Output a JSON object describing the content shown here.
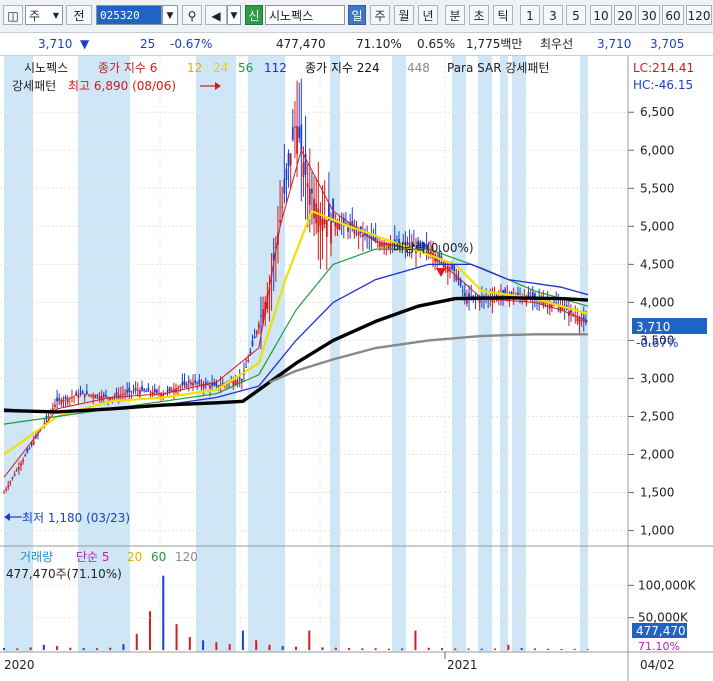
{
  "toolbar": {
    "item_label": "주",
    "prev_label": "전",
    "code": "025320",
    "stock_name": "시노펙스",
    "new_badge": "신",
    "periods": [
      "일",
      "주",
      "월",
      "년",
      "분",
      "초",
      "틱"
    ],
    "active_period": "일",
    "numbers": [
      "1",
      "3",
      "5",
      "10",
      "20",
      "30",
      "60",
      "120"
    ]
  },
  "quote": {
    "price": "3,710",
    "change": "25",
    "change_pct": "-0.67%",
    "volume": "477,470",
    "vol_ratio": "71.10%",
    "turnover": "0.65%",
    "amount": "1,775백만",
    "priority_label": "최우선",
    "ask": "3,710",
    "bid": "3,705",
    "colors": {
      "down": "#1a3fcf",
      "up": "#d21b1b"
    }
  },
  "price_panel": {
    "legend": [
      {
        "label": "시노펙스",
        "color": "#222222"
      },
      {
        "label": "종가 지수 6",
        "color": "#d21b1b"
      },
      {
        "label": "12",
        "color": "#e0b000"
      },
      {
        "label": "24",
        "color": "#d8d800"
      },
      {
        "label": "56",
        "color": "#1f9b3a"
      },
      {
        "label": "112",
        "color": "#1f2fcf"
      },
      {
        "label": "종가 지수 224",
        "color": "#111111"
      },
      {
        "label": "448",
        "color": "#888888"
      },
      {
        "label": "Para SAR 강세패턴",
        "color": "#222222"
      }
    ],
    "legend_line2": "강세패턴",
    "lc": "LC:214.41",
    "hc": "HC:-46.15",
    "annotation_high": "최고 6,890 (08/06)",
    "annotation_low": "최저 1,180 (03/23)",
    "annotation_ex": "배당락(0.00%)",
    "current_price_tag": "3,710",
    "current_change_tag": "-0.67%",
    "tick_labels": [
      "6,500",
      "6,000",
      "5,500",
      "5,000",
      "4,500",
      "4,000",
      "3,500",
      "3,000",
      "2,500",
      "2,000",
      "1,500",
      "1,000"
    ]
  },
  "volume_panel": {
    "legend": [
      {
        "label": "거래량",
        "color": "#1f8fcf"
      },
      {
        "label": "단순 5",
        "color": "#c01bc0"
      },
      {
        "label": "20",
        "color": "#e0b000"
      },
      {
        "label": "60",
        "color": "#1f9b3a"
      },
      {
        "label": "120",
        "color": "#888888"
      }
    ],
    "info": "477,470주(71.10%)",
    "tick_labels": [
      "100,000K",
      "50,000K"
    ],
    "current_tag": "477,470",
    "current_pct": "71.10%"
  },
  "x_axis": {
    "labels": [
      "2020",
      "2021",
      "04/02"
    ]
  },
  "chart_data": {
    "type": "line",
    "title": "시노펙스",
    "y_range": [
      850,
      6950
    ],
    "y_ticks": [
      1000,
      1500,
      2000,
      2500,
      3000,
      3500,
      4000,
      4500,
      5000,
      5500,
      6000,
      6500
    ],
    "y_tick_labels": [
      "1,000",
      "1,500",
      "2,000",
      "2,500",
      "3,000",
      "3,500",
      "4,000",
      "4,500",
      "5,000",
      "5,500",
      "6,000",
      "6,500"
    ],
    "x_labels": [
      "2020",
      "2021",
      "04/02"
    ],
    "series": [
      {
        "name": "시노펙스",
        "points": [
          [
            0,
            1500
          ],
          [
            5,
            2100
          ],
          [
            10,
            2700
          ],
          [
            15,
            2800
          ],
          [
            20,
            2750
          ],
          [
            25,
            2850
          ],
          [
            30,
            2800
          ],
          [
            35,
            2950
          ],
          [
            40,
            2900
          ],
          [
            45,
            3000
          ],
          [
            50,
            4200
          ],
          [
            55,
            6400
          ],
          [
            57,
            5600
          ],
          [
            60,
            5100
          ],
          [
            65,
            5000
          ],
          [
            70,
            4800
          ],
          [
            75,
            4750
          ],
          [
            80,
            4700
          ],
          [
            85,
            4400
          ],
          [
            87,
            4050
          ],
          [
            90,
            4050
          ],
          [
            95,
            4100
          ],
          [
            100,
            4050
          ],
          [
            105,
            3950
          ],
          [
            110,
            3710
          ]
        ]
      },
      {
        "name": "6",
        "points": [
          [
            0,
            1700
          ],
          [
            10,
            2600
          ],
          [
            20,
            2750
          ],
          [
            30,
            2800
          ],
          [
            40,
            2950
          ],
          [
            48,
            3400
          ],
          [
            52,
            5000
          ],
          [
            56,
            6000
          ],
          [
            62,
            5200
          ],
          [
            70,
            4800
          ],
          [
            80,
            4650
          ],
          [
            86,
            4300
          ],
          [
            90,
            4050
          ],
          [
            100,
            4000
          ],
          [
            105,
            3900
          ],
          [
            110,
            3750
          ]
        ]
      },
      {
        "name": "24",
        "points": [
          [
            0,
            2000
          ],
          [
            10,
            2500
          ],
          [
            20,
            2700
          ],
          [
            30,
            2750
          ],
          [
            40,
            2850
          ],
          [
            48,
            3200
          ],
          [
            53,
            4300
          ],
          [
            58,
            5200
          ],
          [
            65,
            5000
          ],
          [
            75,
            4750
          ],
          [
            85,
            4500
          ],
          [
            90,
            4150
          ],
          [
            100,
            4050
          ],
          [
            110,
            3850
          ]
        ]
      },
      {
        "name": "56",
        "points": [
          [
            0,
            2400
          ],
          [
            10,
            2500
          ],
          [
            20,
            2600
          ],
          [
            30,
            2700
          ],
          [
            40,
            2800
          ],
          [
            48,
            3050
          ],
          [
            55,
            3900
          ],
          [
            62,
            4500
          ],
          [
            70,
            4700
          ],
          [
            80,
            4700
          ],
          [
            90,
            4450
          ],
          [
            100,
            4150
          ],
          [
            110,
            3950
          ]
        ]
      },
      {
        "name": "112",
        "points": [
          [
            0,
            2600
          ],
          [
            10,
            2550
          ],
          [
            20,
            2600
          ],
          [
            30,
            2650
          ],
          [
            40,
            2750
          ],
          [
            48,
            2900
          ],
          [
            55,
            3500
          ],
          [
            62,
            4000
          ],
          [
            70,
            4300
          ],
          [
            80,
            4500
          ],
          [
            88,
            4500
          ],
          [
            95,
            4300
          ],
          [
            105,
            4200
          ],
          [
            110,
            4100
          ]
        ]
      },
      {
        "name": "224",
        "points": [
          [
            0,
            2580
          ],
          [
            10,
            2560
          ],
          [
            20,
            2600
          ],
          [
            30,
            2650
          ],
          [
            40,
            2680
          ],
          [
            45,
            2700
          ],
          [
            50,
            2950
          ],
          [
            55,
            3200
          ],
          [
            62,
            3500
          ],
          [
            70,
            3750
          ],
          [
            78,
            3950
          ],
          [
            85,
            4050
          ],
          [
            95,
            4060
          ],
          [
            105,
            4050
          ],
          [
            110,
            4030
          ]
        ]
      },
      {
        "name": "448",
        "points": [
          [
            50,
            2950
          ],
          [
            55,
            3100
          ],
          [
            62,
            3250
          ],
          [
            70,
            3400
          ],
          [
            80,
            3500
          ],
          [
            90,
            3560
          ],
          [
            100,
            3580
          ],
          [
            110,
            3580
          ]
        ]
      }
    ],
    "volume": {
      "y_range": [
        0,
        130000
      ],
      "unit": "K",
      "values": [
        3000,
        2500,
        4000,
        8000,
        6000,
        3500,
        3000,
        2800,
        3500,
        9000,
        25000,
        60000,
        115000,
        40000,
        20000,
        15000,
        12000,
        9000,
        30000,
        15000,
        8000,
        6000,
        5000,
        30000,
        4000,
        3500,
        3000,
        2500,
        2800,
        2000,
        2500,
        30000,
        3500,
        2800,
        2400,
        2200,
        2000,
        2200,
        8000,
        3000,
        2500,
        2000,
        1500,
        1800,
        1200
      ]
    }
  }
}
